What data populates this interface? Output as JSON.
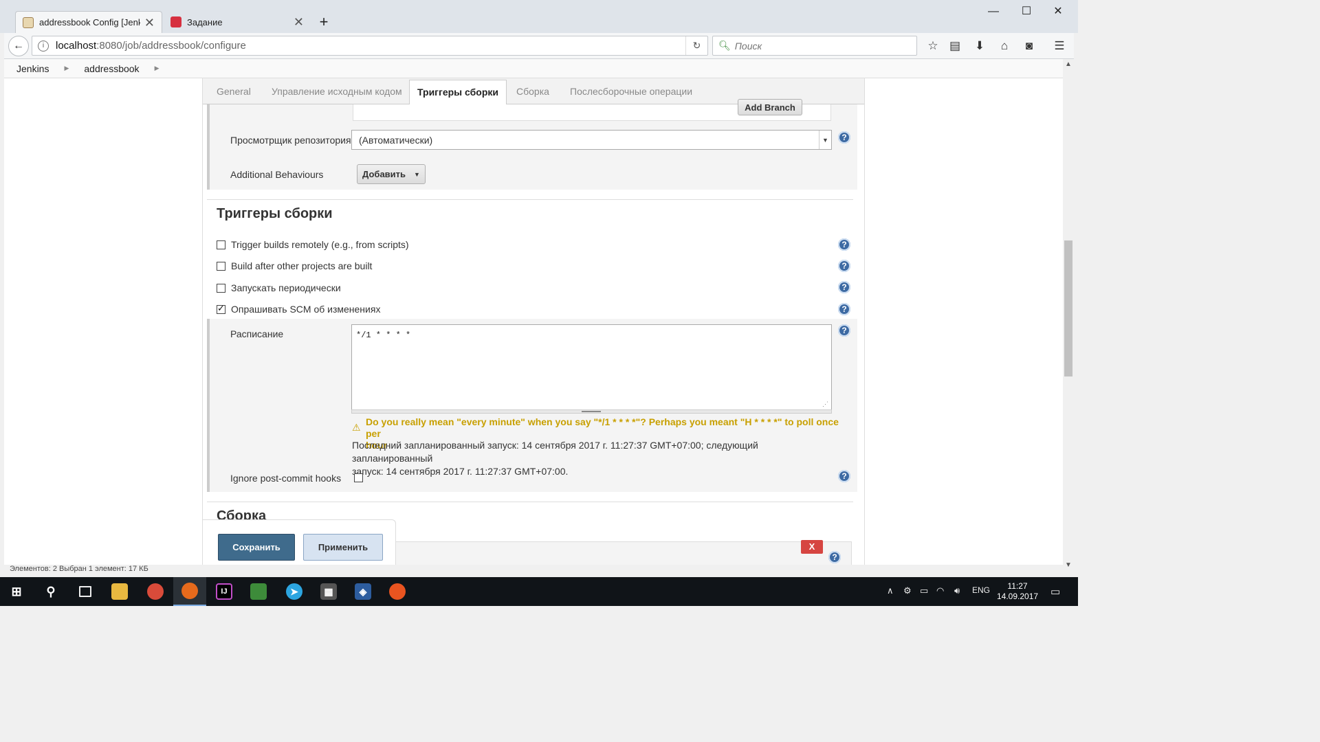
{
  "browser": {
    "tabs": [
      {
        "title": "addressbook Config [Jenki...",
        "active": true
      },
      {
        "title": "Задание",
        "active": false
      }
    ],
    "new_tab": "+",
    "url_host": "localhost",
    "url_path": ":8080/job/addressbook/configure",
    "search_placeholder": "Поиск"
  },
  "breadcrumb": [
    "Jenkins",
    "addressbook"
  ],
  "config_tabs": [
    {
      "label": "General",
      "active": false
    },
    {
      "label": "Управление исходным кодом",
      "active": false
    },
    {
      "label": "Триггеры сборки",
      "active": true
    },
    {
      "label": "Сборка",
      "active": false
    },
    {
      "label": "Послесборочные операции",
      "active": false
    }
  ],
  "scm": {
    "add_branch_label": "Add Branch",
    "repo_browser_label": "Просмотрщик репозитория",
    "repo_browser_value": "(Автоматически)",
    "additional_behaviours_label": "Additional Behaviours",
    "add_button_label": "Добавить"
  },
  "triggers": {
    "heading": "Триггеры сборки",
    "options": [
      {
        "label": "Trigger builds remotely (e.g., from scripts)",
        "checked": false
      },
      {
        "label": "Build after other projects are built",
        "checked": false
      },
      {
        "label": "Запускать периодически",
        "checked": false
      },
      {
        "label": "Опрашивать SCM об изменениях",
        "checked": true
      }
    ],
    "schedule_label": "Расписание",
    "schedule_value": "*/1 * * * *",
    "warning_line1": "Do you really mean \"every minute\" when you say \"*/1 * * * *\"? Perhaps you meant \"H * * * *\" to poll once per",
    "warning_line2": "hour",
    "info_line1": "Последний запланированный запуск: 14 сентября 2017 г. 11:27:37 GMT+07:00; следующий запланированный",
    "info_line2": "запуск: 14 сентября 2017 г. 11:27:37 GMT+07:00.",
    "ignore_hooks_label": "Ignore post-commit hooks",
    "ignore_hooks_checked": false
  },
  "build": {
    "heading": "Сборка",
    "delete_label": "X"
  },
  "actions": {
    "save_label": "Сохранить",
    "apply_label": "Применить"
  },
  "explorer_status": "Элементов: 2     Выбран 1 элемент: 17 КБ",
  "taskbar": {
    "language": "ENG",
    "time": "11:27",
    "date": "14.09.2017"
  },
  "colors": {
    "help_icon": "#3d6aa3",
    "save_button": "#3f6b8c",
    "apply_button": "#d7e3f1",
    "warning": "#c8a000",
    "delete_button": "#d64541"
  }
}
